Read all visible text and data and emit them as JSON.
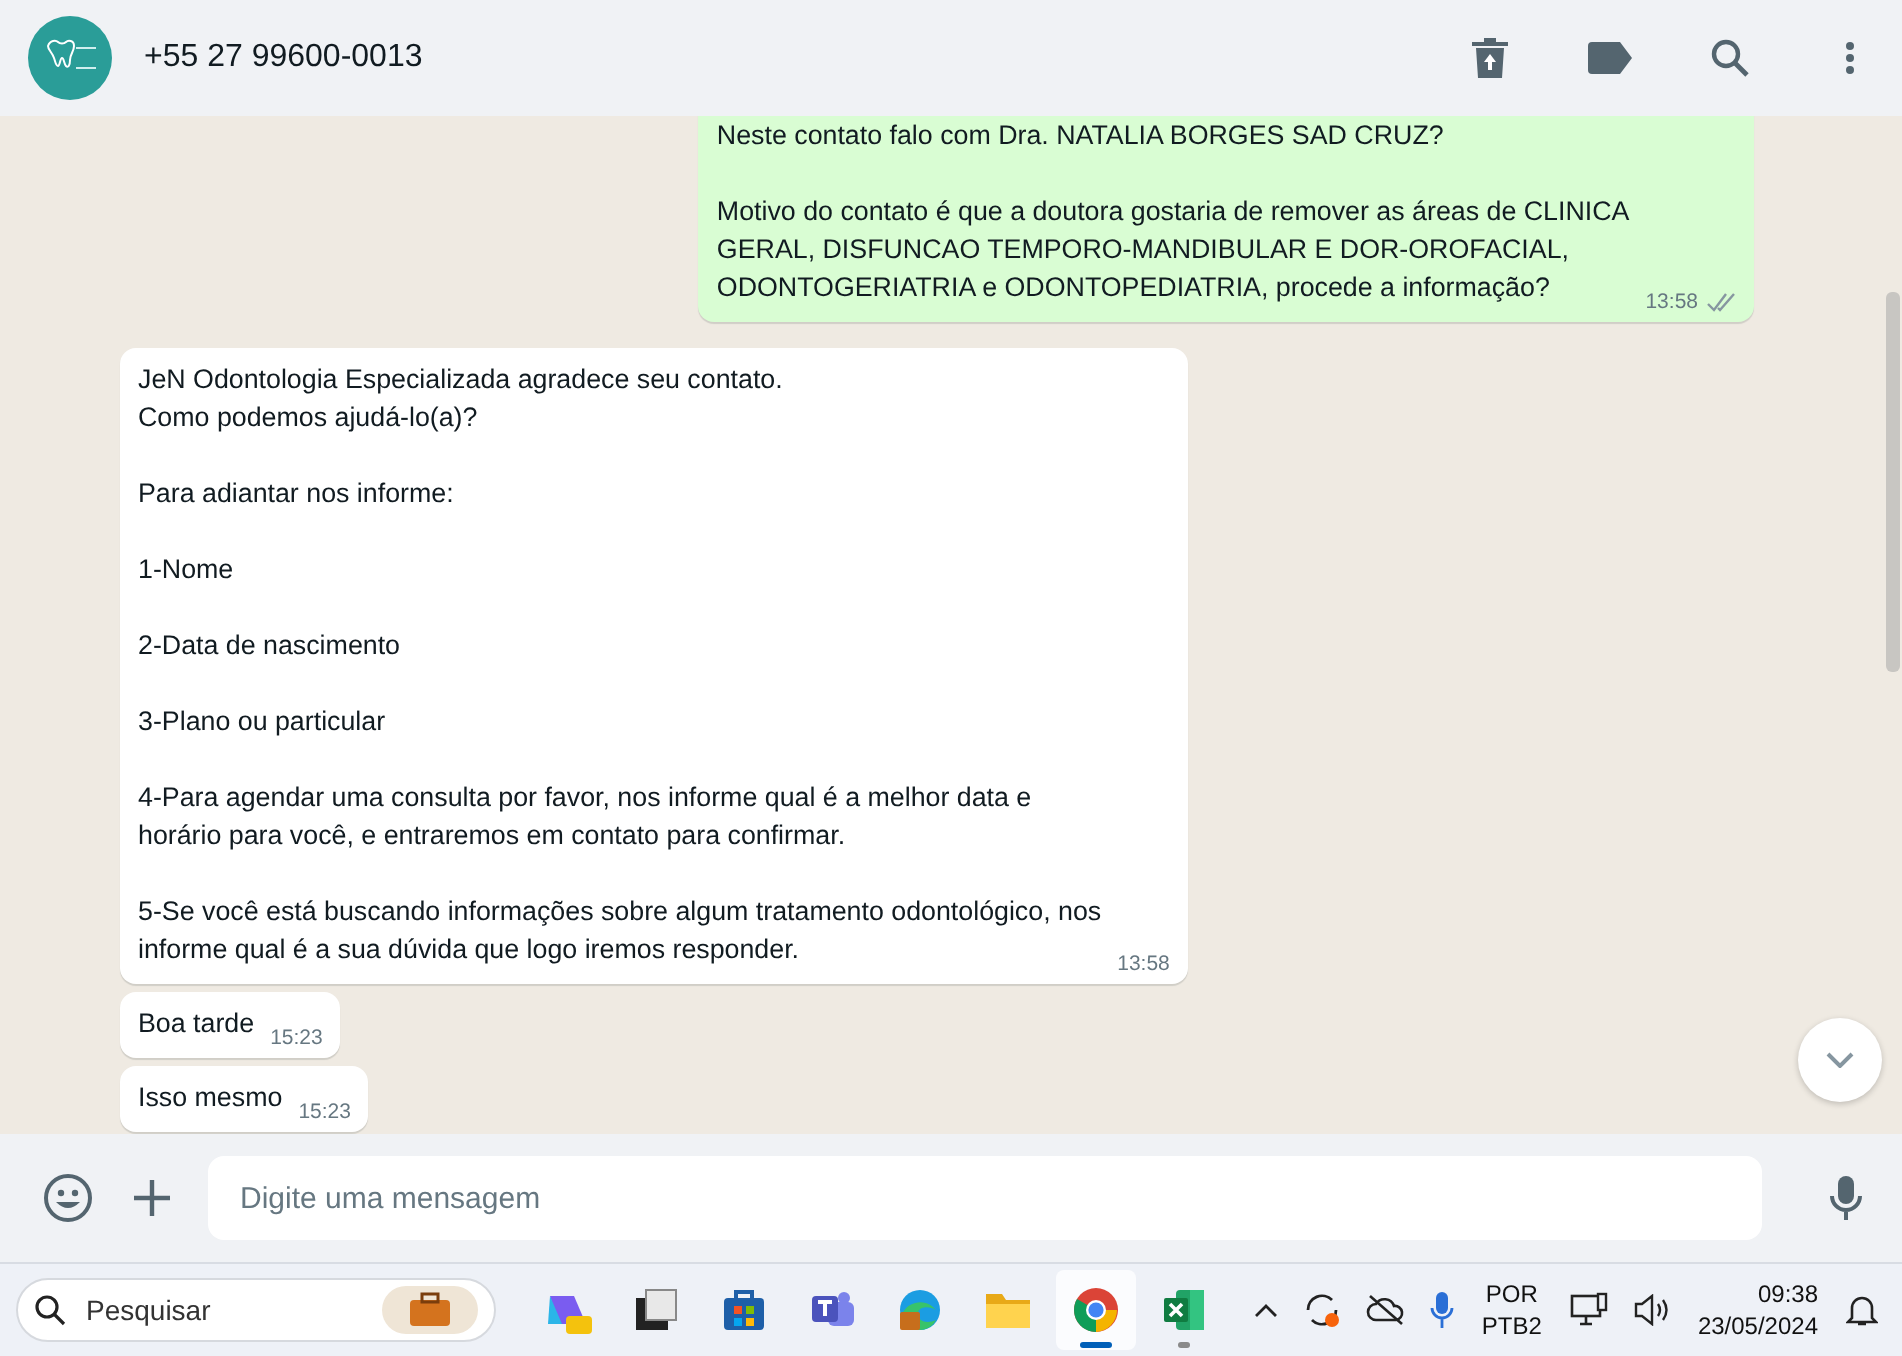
{
  "header": {
    "contact": "+55 27 99600-0013"
  },
  "messages": [
    {
      "kind": "outgoing",
      "paragraphs": [
        [
          "Neste contato falo com Dra. NATALIA BORGES SAD CRUZ?"
        ],
        [
          "Motivo do contato é que a doutora gostaria de remover as áreas de CLINICA",
          "GERAL, DISFUNCAO TEMPORO-MANDIBULAR E DOR-OROFACIAL,",
          "ODONTOGERIATRIA e ODONTOPEDIATRIA, procede a informação?"
        ]
      ],
      "time": "13:58",
      "read": false
    },
    {
      "kind": "incoming",
      "paragraphs": [
        [
          "JeN Odontologia Especializada agradece seu contato.",
          "Como podemos ajudá-lo(a)?"
        ],
        [
          "Para adiantar nos informe:"
        ],
        [
          "1-Nome"
        ],
        [
          "2-Data de nascimento"
        ],
        [
          "3-Plano ou particular"
        ],
        [
          "4-Para agendar uma consulta por favor, nos informe qual é a melhor data e",
          "horário para você, e entraremos em contato para confirmar."
        ],
        [
          "5-Se você está buscando informações sobre algum tratamento odontológico, nos",
          "informe qual é a sua dúvida que logo iremos responder."
        ]
      ],
      "time": "13:58"
    },
    {
      "kind": "incoming",
      "paragraphs": [
        [
          "Boa tarde"
        ]
      ],
      "time": "15:23"
    },
    {
      "kind": "incoming",
      "paragraphs": [
        [
          "Isso mesmo"
        ]
      ],
      "time": "15:23"
    }
  ],
  "composer": {
    "placeholder": "Digite uma mensagem"
  },
  "taskbar": {
    "search": {
      "placeholder": "Pesquisar"
    },
    "apps": [
      {
        "kind": "copilot",
        "selected": false,
        "running": false
      },
      {
        "kind": "windows",
        "selected": false,
        "running": false
      },
      {
        "kind": "store",
        "selected": false,
        "running": false
      },
      {
        "kind": "teams",
        "selected": false,
        "running": false
      },
      {
        "kind": "edge",
        "selected": false,
        "running": false
      },
      {
        "kind": "folder",
        "selected": false,
        "running": false
      },
      {
        "kind": "chrome",
        "selected": true,
        "running": true
      },
      {
        "kind": "excel",
        "selected": false,
        "running": true
      }
    ],
    "language": [
      "POR",
      "PTB2"
    ],
    "time": "09:38",
    "date": "23/05/2024"
  }
}
